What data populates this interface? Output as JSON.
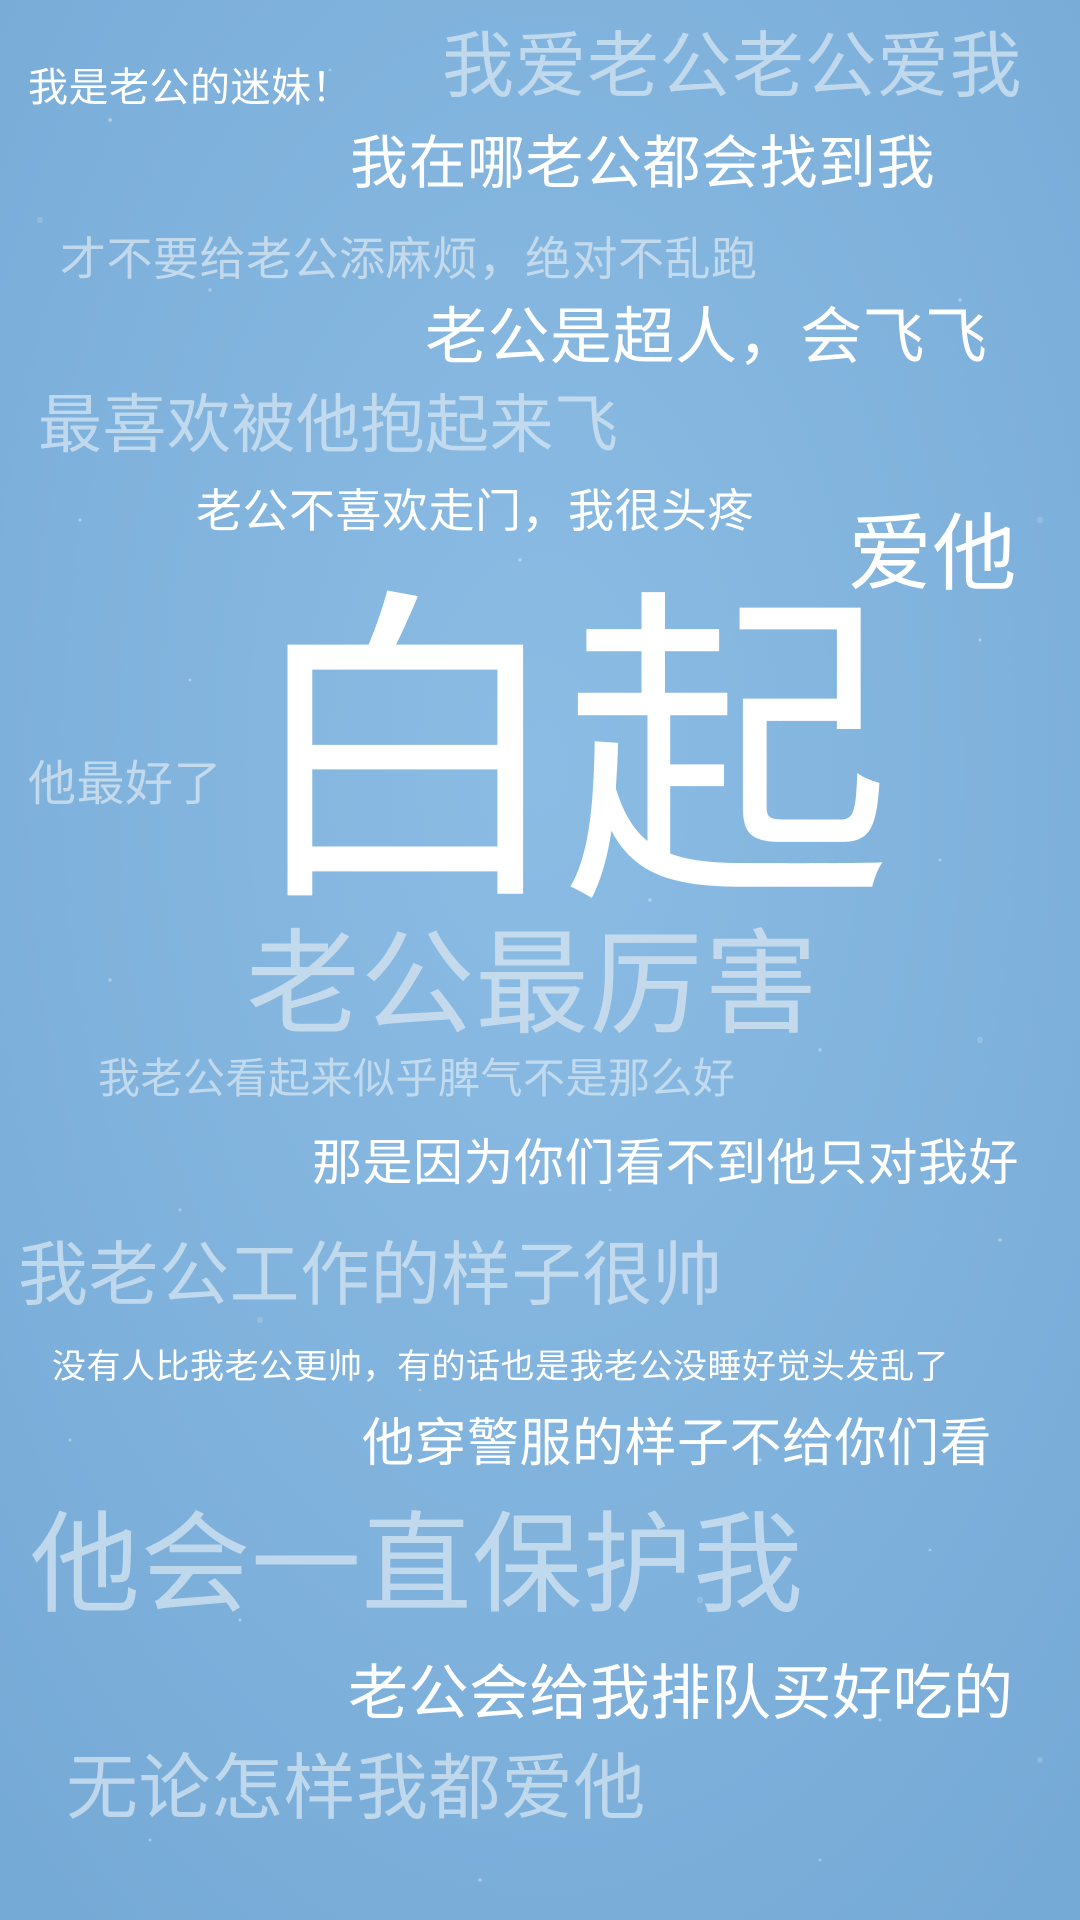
{
  "colors": {
    "background": "#7eb1db",
    "text_white": "#ffffff",
    "text_faint": "#cfe0ef"
  },
  "lines": [
    "我是老公的迷妹！",
    "我爱老公老公爱我",
    "我在哪老公都会找到我",
    "才不要给老公添麻烦，绝对不乱跑",
    "老公是超人，会飞飞",
    "最喜欢被他抱起来飞",
    "老公不喜欢走门，我很头疼",
    "爱他",
    "他最好了",
    "白起",
    "老公最厉害",
    "我老公看起来似乎脾气不是那么好",
    "那是因为你们看不到他只对我好",
    "我老公工作的样子很帅",
    "没有人比我老公更帅，有的话也是我老公没睡好觉头发乱了",
    "他穿警服的样子不给你们看",
    "他会一直保护我",
    "老公会给我排队买好吃的",
    "无论怎样我都爱他"
  ]
}
